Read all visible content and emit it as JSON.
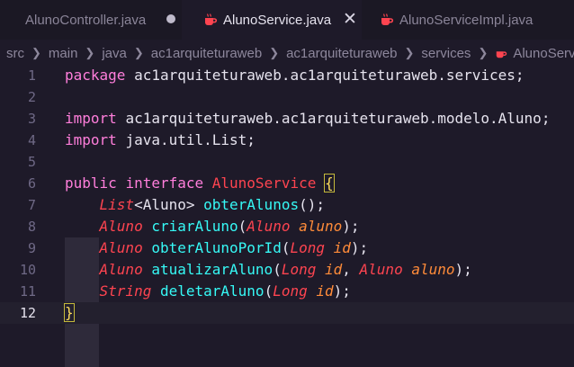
{
  "tabs": [
    {
      "label": "AlunoController.java",
      "dirty": true
    },
    {
      "label": "AlunoService.java",
      "active": true,
      "close": "✕"
    },
    {
      "label": "AlunoServiceImpl.java"
    }
  ],
  "breadcrumb": [
    "src",
    "main",
    "java",
    "ac1arquiteturaweb",
    "ac1arquiteturaweb",
    "services",
    "AlunoService.java"
  ],
  "colors": {
    "keyword": "#ff7edb",
    "type": "#fe4450",
    "function": "#36f9f6",
    "param": "#ff8b39",
    "brace": "#fede5d"
  },
  "lines": [
    {
      "n": "1",
      "tokens": [
        [
          "kw",
          "package "
        ],
        [
          "pn",
          "ac1arquiteturaweb.ac1arquiteturaweb.services;"
        ]
      ]
    },
    {
      "n": "2",
      "tokens": []
    },
    {
      "n": "3",
      "tokens": [
        [
          "kw",
          "import "
        ],
        [
          "pn",
          "ac1arquiteturaweb.ac1arquiteturaweb.modelo.Aluno;"
        ]
      ]
    },
    {
      "n": "4",
      "tokens": [
        [
          "kw",
          "import "
        ],
        [
          "pn",
          "java.util.List;"
        ]
      ]
    },
    {
      "n": "5",
      "tokens": []
    },
    {
      "n": "6",
      "tokens": [
        [
          "kw",
          "public "
        ],
        [
          "kw",
          "interface "
        ],
        [
          "ty",
          "AlunoService "
        ],
        [
          "brace-hl",
          "{"
        ]
      ]
    },
    {
      "n": "7",
      "tokens": [
        [
          "pn",
          "    "
        ],
        [
          "tyi",
          "List"
        ],
        [
          "pn",
          "<Aluno> "
        ],
        [
          "fn",
          "obterAlunos"
        ],
        [
          "pn",
          "();"
        ]
      ]
    },
    {
      "n": "8",
      "tokens": [
        [
          "pn",
          "    "
        ],
        [
          "tyi",
          "Aluno "
        ],
        [
          "fn",
          "criarAluno"
        ],
        [
          "pn",
          "("
        ],
        [
          "tyi",
          "Aluno "
        ],
        [
          "prm",
          "aluno"
        ],
        [
          "pn",
          ");"
        ]
      ]
    },
    {
      "n": "9",
      "tokens": [
        [
          "pn",
          "    "
        ],
        [
          "tyi",
          "Aluno "
        ],
        [
          "fn",
          "obterAlunoPorId"
        ],
        [
          "pn",
          "("
        ],
        [
          "tyi",
          "Long "
        ],
        [
          "prm",
          "id"
        ],
        [
          "pn",
          ");"
        ]
      ]
    },
    {
      "n": "10",
      "tokens": [
        [
          "pn",
          "    "
        ],
        [
          "tyi",
          "Aluno "
        ],
        [
          "fn",
          "atualizarAluno"
        ],
        [
          "pn",
          "("
        ],
        [
          "tyi",
          "Long "
        ],
        [
          "prm",
          "id"
        ],
        [
          "pn",
          ", "
        ],
        [
          "tyi",
          "Aluno "
        ],
        [
          "prm",
          "aluno"
        ],
        [
          "pn",
          ");"
        ]
      ]
    },
    {
      "n": "11",
      "tokens": [
        [
          "pn",
          "    "
        ],
        [
          "tyi",
          "String "
        ],
        [
          "fn",
          "deletarAluno"
        ],
        [
          "pn",
          "("
        ],
        [
          "tyi",
          "Long "
        ],
        [
          "prm",
          "id"
        ],
        [
          "pn",
          ");"
        ]
      ]
    },
    {
      "n": "12",
      "tokens": [
        [
          "brace-hl",
          "}"
        ]
      ],
      "current": true
    }
  ]
}
